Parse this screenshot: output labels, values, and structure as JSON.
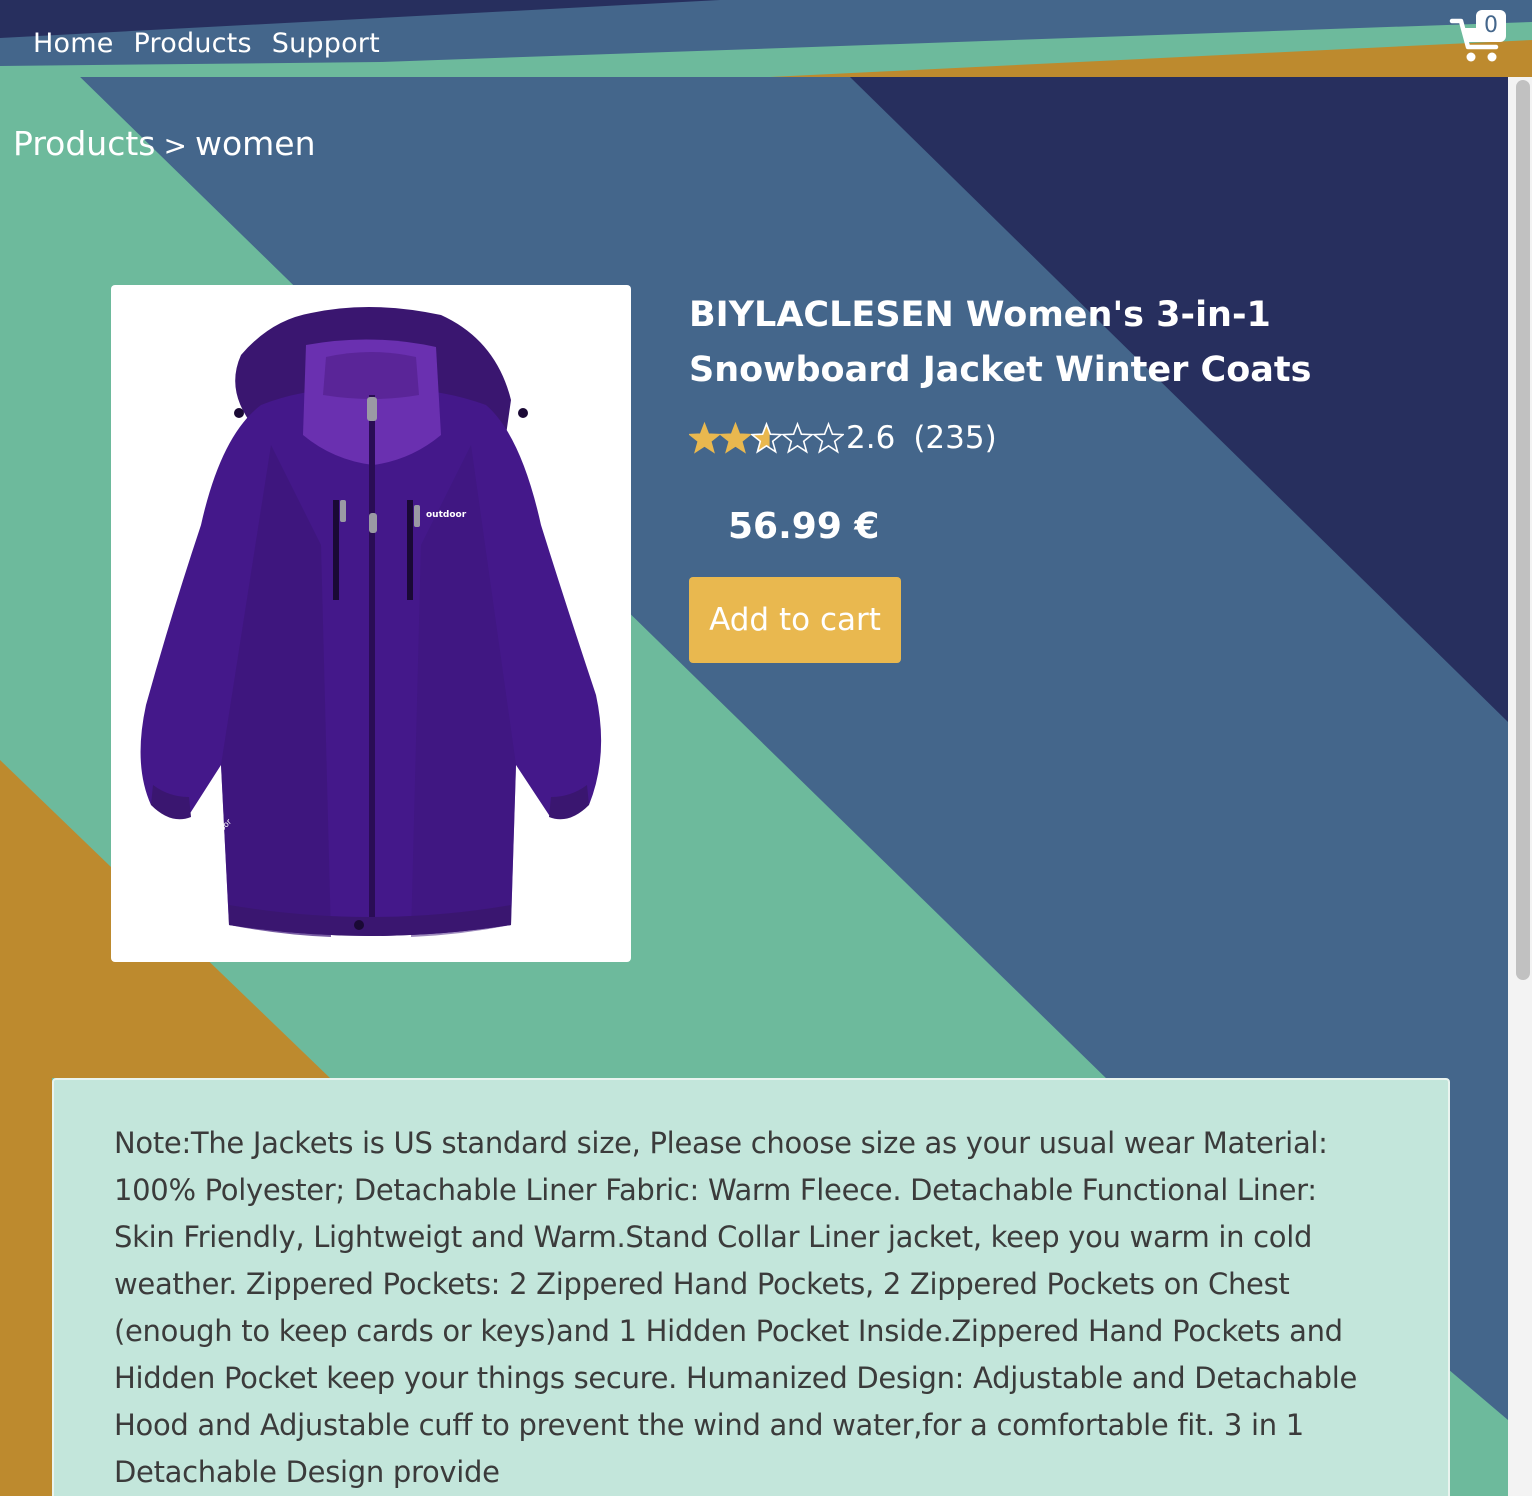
{
  "nav": {
    "links": [
      {
        "label": "Home"
      },
      {
        "label": "Products"
      },
      {
        "label": "Support"
      }
    ],
    "cart_count": "0"
  },
  "breadcrumb": {
    "items": [
      "Products",
      "women"
    ],
    "separator": ">"
  },
  "product": {
    "title": "BIYLACLESEN Women's 3-in-1 Snowboard Jacket Winter Coats",
    "rating": 2.6,
    "rating_text": "2.6",
    "review_count": "(235)",
    "price": "56.99 €",
    "add_to_cart_label": "Add to cart",
    "image_icon": "purple-jacket-image",
    "description": "Note:The Jackets is US standard size, Please choose size as your usual wear Material: 100% Polyester; Detachable Liner Fabric: Warm Fleece. Detachable Functional Liner: Skin Friendly, Lightweigt and Warm.Stand Collar Liner jacket, keep you warm in cold weather. Zippered Pockets: 2 Zippered Hand Pockets, 2 Zippered Pockets on Chest (enough to keep cards or keys)and 1 Hidden Pocket Inside.Zippered Hand Pockets and Hidden Pocket keep your things secure. Humanized Design: Adjustable and Detachable Hood and Adjustable cuff to prevent the wind and water,for a comfortable fit. 3 in 1 Detachable Design provide"
  },
  "colors": {
    "navy": "#272f5e",
    "slate_blue": "#44668b",
    "teal": "#6dba9c",
    "mustard": "#bd8a2e",
    "button": "#e9b84f",
    "description_bg": "#c3e6db",
    "star": "#e9b84f"
  }
}
